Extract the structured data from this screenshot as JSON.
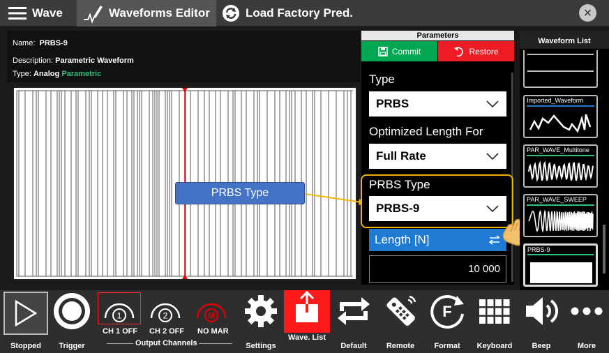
{
  "topbar": {
    "wave_label": "Wave",
    "editor_label": "Waveforms Editor",
    "load_label": "Load Factory Pred."
  },
  "info": {
    "name_label": "Name:",
    "name_value": "PRBS-9",
    "description_label": "Description:",
    "description_value": "Parametric Waveform",
    "type_label": "Type:",
    "type_value": "Analog",
    "type_sub": "Parametric"
  },
  "callout": {
    "text": "PRBS Type"
  },
  "parameters": {
    "title": "Parameters",
    "commit_label": "Commit",
    "restore_label": "Restore",
    "type_label": "Type",
    "type_value": "PRBS",
    "opt_label": "Optimized Length For",
    "opt_value": "Full Rate",
    "prbs_label": "PRBS Type",
    "prbs_value": "PRBS-9",
    "length_label": "Length [N]",
    "length_value": "10 000"
  },
  "waveform_list": {
    "title": "Waveform List",
    "items": [
      {
        "name": ""
      },
      {
        "name": "Imported_Waveform"
      },
      {
        "name": "PAR_WAVE_Multitone"
      },
      {
        "name": "PAR_WAVE_SWEEP"
      },
      {
        "name": "PRBS-9"
      }
    ]
  },
  "bottombar": {
    "stopped": "Stopped",
    "trigger": "Trigger",
    "ch1": "CH 1 OFF",
    "ch2": "CH 2 OFF",
    "nomar": "NO MAR",
    "output_channels": "Output Channels",
    "settings": "Settings",
    "wave_list": "Wave. List",
    "default": "Default",
    "remote": "Remote",
    "format": "Format",
    "keyboard": "Keyboard",
    "beep": "Beep",
    "more": "More",
    "ch1_digit": "1",
    "ch2_digit": "2",
    "mar_letter": "M",
    "format_letter": "F"
  },
  "colors": {
    "commit": "#00a651",
    "restore": "#ed1c24",
    "accent_blue": "#1f7ad4",
    "highlight": "#f0b400",
    "callout": "#4472c4",
    "wave_list_active": "#ff1a1a",
    "marker": "#e00000"
  }
}
